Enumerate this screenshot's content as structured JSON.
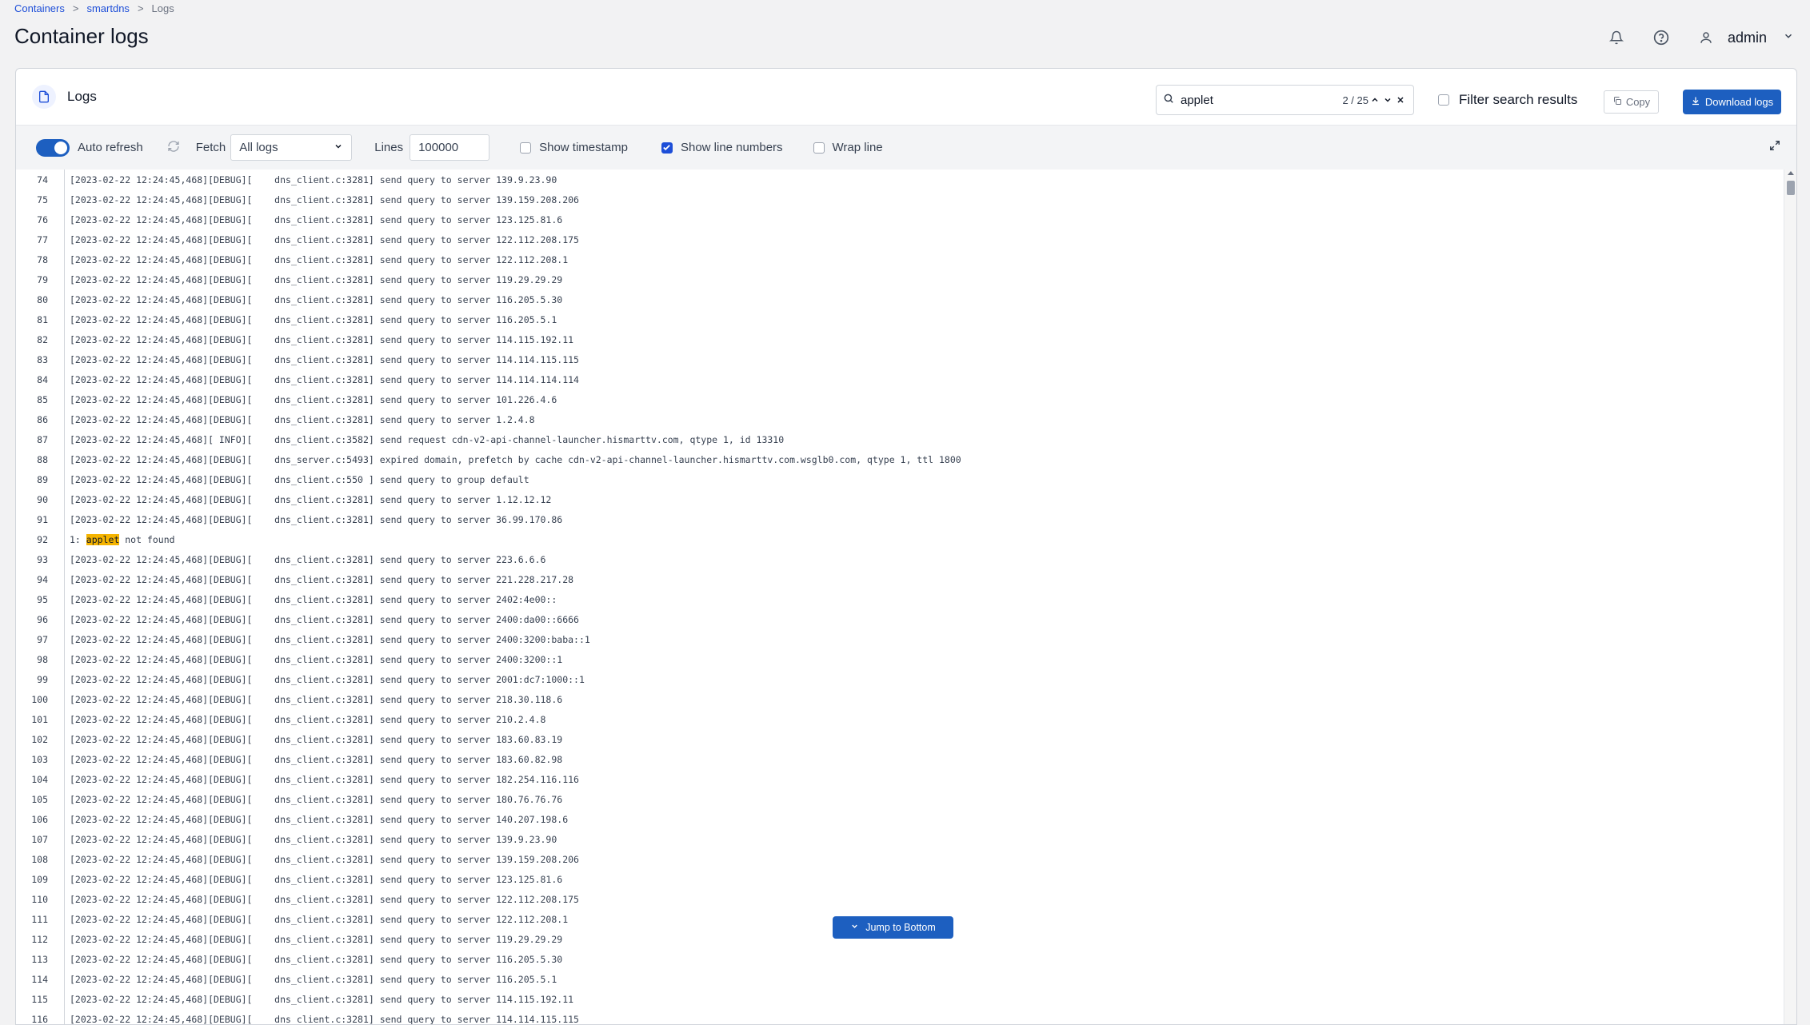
{
  "breadcrumb": {
    "items": [
      "Containers",
      "smartdns",
      "Logs"
    ],
    "separator": ">"
  },
  "page": {
    "title": "Container logs"
  },
  "user": {
    "name": "admin"
  },
  "card": {
    "title": "Logs"
  },
  "search": {
    "value": "applet",
    "match_count": "2 / 25"
  },
  "filter": {
    "label": "Filter search results",
    "checked": false
  },
  "actions": {
    "copy_label": "Copy",
    "download_label": "Download logs"
  },
  "toolbar": {
    "auto_refresh_label": "Auto refresh",
    "auto_refresh_on": true,
    "fetch_label": "Fetch",
    "fetch_value": "All logs",
    "lines_label": "Lines",
    "lines_value": "100000",
    "show_timestamp_label": "Show timestamp",
    "show_timestamp": false,
    "show_line_numbers_label": "Show line numbers",
    "show_line_numbers": true,
    "wrap_line_label": "Wrap line",
    "wrap_line": false
  },
  "jump_bottom_label": "Jump to Bottom",
  "colors": {
    "accent": "#1d5fc0",
    "highlight": "#f5b400"
  },
  "log_lines": [
    {
      "n": "74",
      "text": "[2023-02-22 12:24:45,468][DEBUG][    dns_client.c:3281] send query to server 139.9.23.90"
    },
    {
      "n": "75",
      "text": "[2023-02-22 12:24:45,468][DEBUG][    dns_client.c:3281] send query to server 139.159.208.206"
    },
    {
      "n": "76",
      "text": "[2023-02-22 12:24:45,468][DEBUG][    dns_client.c:3281] send query to server 123.125.81.6"
    },
    {
      "n": "77",
      "text": "[2023-02-22 12:24:45,468][DEBUG][    dns_client.c:3281] send query to server 122.112.208.175"
    },
    {
      "n": "78",
      "text": "[2023-02-22 12:24:45,468][DEBUG][    dns_client.c:3281] send query to server 122.112.208.1"
    },
    {
      "n": "79",
      "text": "[2023-02-22 12:24:45,468][DEBUG][    dns_client.c:3281] send query to server 119.29.29.29"
    },
    {
      "n": "80",
      "text": "[2023-02-22 12:24:45,468][DEBUG][    dns_client.c:3281] send query to server 116.205.5.30"
    },
    {
      "n": "81",
      "text": "[2023-02-22 12:24:45,468][DEBUG][    dns_client.c:3281] send query to server 116.205.5.1"
    },
    {
      "n": "82",
      "text": "[2023-02-22 12:24:45,468][DEBUG][    dns_client.c:3281] send query to server 114.115.192.11"
    },
    {
      "n": "83",
      "text": "[2023-02-22 12:24:45,468][DEBUG][    dns_client.c:3281] send query to server 114.114.115.115"
    },
    {
      "n": "84",
      "text": "[2023-02-22 12:24:45,468][DEBUG][    dns_client.c:3281] send query to server 114.114.114.114"
    },
    {
      "n": "85",
      "text": "[2023-02-22 12:24:45,468][DEBUG][    dns_client.c:3281] send query to server 101.226.4.6"
    },
    {
      "n": "86",
      "text": "[2023-02-22 12:24:45,468][DEBUG][    dns_client.c:3281] send query to server 1.2.4.8"
    },
    {
      "n": "87",
      "text": "[2023-02-22 12:24:45,468][ INFO][    dns_client.c:3582] send request cdn-v2-api-channel-launcher.hismarttv.com, qtype 1, id 13310"
    },
    {
      "n": "88",
      "text": "[2023-02-22 12:24:45,468][DEBUG][    dns_server.c:5493] expired domain, prefetch by cache cdn-v2-api-channel-launcher.hismarttv.com.wsglb0.com, qtype 1, ttl 1800"
    },
    {
      "n": "89",
      "text": "[2023-02-22 12:24:45,468][DEBUG][    dns_client.c:550 ] send query to group default"
    },
    {
      "n": "90",
      "text": "[2023-02-22 12:24:45,468][DEBUG][    dns_client.c:3281] send query to server 1.12.12.12"
    },
    {
      "n": "91",
      "text": "[2023-02-22 12:24:45,468][DEBUG][    dns_client.c:3281] send query to server 36.99.170.86"
    },
    {
      "n": "92",
      "pre": "1: ",
      "match": "applet",
      "post": " not found"
    },
    {
      "n": "93",
      "text": "[2023-02-22 12:24:45,468][DEBUG][    dns_client.c:3281] send query to server 223.6.6.6"
    },
    {
      "n": "94",
      "text": "[2023-02-22 12:24:45,468][DEBUG][    dns_client.c:3281] send query to server 221.228.217.28"
    },
    {
      "n": "95",
      "text": "[2023-02-22 12:24:45,468][DEBUG][    dns_client.c:3281] send query to server 2402:4e00::"
    },
    {
      "n": "96",
      "text": "[2023-02-22 12:24:45,468][DEBUG][    dns_client.c:3281] send query to server 2400:da00::6666"
    },
    {
      "n": "97",
      "text": "[2023-02-22 12:24:45,468][DEBUG][    dns_client.c:3281] send query to server 2400:3200:baba::1"
    },
    {
      "n": "98",
      "text": "[2023-02-22 12:24:45,468][DEBUG][    dns_client.c:3281] send query to server 2400:3200::1"
    },
    {
      "n": "99",
      "text": "[2023-02-22 12:24:45,468][DEBUG][    dns_client.c:3281] send query to server 2001:dc7:1000::1"
    },
    {
      "n": "100",
      "text": "[2023-02-22 12:24:45,468][DEBUG][    dns_client.c:3281] send query to server 218.30.118.6"
    },
    {
      "n": "101",
      "text": "[2023-02-22 12:24:45,468][DEBUG][    dns_client.c:3281] send query to server 210.2.4.8"
    },
    {
      "n": "102",
      "text": "[2023-02-22 12:24:45,468][DEBUG][    dns_client.c:3281] send query to server 183.60.83.19"
    },
    {
      "n": "103",
      "text": "[2023-02-22 12:24:45,468][DEBUG][    dns_client.c:3281] send query to server 183.60.82.98"
    },
    {
      "n": "104",
      "text": "[2023-02-22 12:24:45,468][DEBUG][    dns_client.c:3281] send query to server 182.254.116.116"
    },
    {
      "n": "105",
      "text": "[2023-02-22 12:24:45,468][DEBUG][    dns_client.c:3281] send query to server 180.76.76.76"
    },
    {
      "n": "106",
      "text": "[2023-02-22 12:24:45,468][DEBUG][    dns_client.c:3281] send query to server 140.207.198.6"
    },
    {
      "n": "107",
      "text": "[2023-02-22 12:24:45,468][DEBUG][    dns_client.c:3281] send query to server 139.9.23.90"
    },
    {
      "n": "108",
      "text": "[2023-02-22 12:24:45,468][DEBUG][    dns_client.c:3281] send query to server 139.159.208.206"
    },
    {
      "n": "109",
      "text": "[2023-02-22 12:24:45,468][DEBUG][    dns_client.c:3281] send query to server 123.125.81.6"
    },
    {
      "n": "110",
      "text": "[2023-02-22 12:24:45,468][DEBUG][    dns_client.c:3281] send query to server 122.112.208.175"
    },
    {
      "n": "111",
      "text": "[2023-02-22 12:24:45,468][DEBUG][    dns_client.c:3281] send query to server 122.112.208.1"
    },
    {
      "n": "112",
      "text": "[2023-02-22 12:24:45,468][DEBUG][    dns_client.c:3281] send query to server 119.29.29.29"
    },
    {
      "n": "113",
      "text": "[2023-02-22 12:24:45,468][DEBUG][    dns_client.c:3281] send query to server 116.205.5.30"
    },
    {
      "n": "114",
      "text": "[2023-02-22 12:24:45,468][DEBUG][    dns_client.c:3281] send query to server 116.205.5.1"
    },
    {
      "n": "115",
      "text": "[2023-02-22 12:24:45,468][DEBUG][    dns_client.c:3281] send query to server 114.115.192.11"
    },
    {
      "n": "116",
      "text": "[2023-02-22 12:24:45,468][DEBUG][    dns_client.c:3281] send query to server 114.114.115.115"
    }
  ]
}
